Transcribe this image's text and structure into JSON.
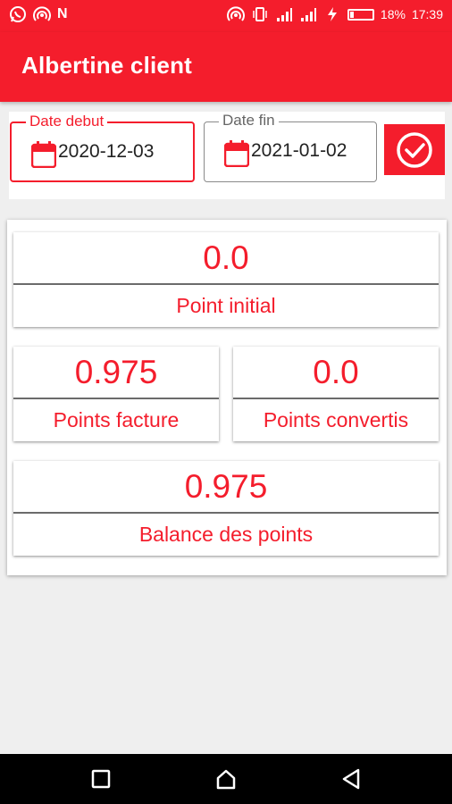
{
  "status_bar": {
    "notification_letter": "N",
    "battery_percent": "18%",
    "battery_level": 0.18,
    "time": "17:39",
    "icons": [
      "whatsapp-icon",
      "hotspot-icon",
      "hotspot-icon",
      "vibrate-icon",
      "signal-icon",
      "signal-icon",
      "charging-icon",
      "battery-icon"
    ]
  },
  "app_bar": {
    "title": "Albertine client"
  },
  "date_filter": {
    "start": {
      "label": "Date debut",
      "value": "2020-12-03"
    },
    "end": {
      "label": "Date fin",
      "value": "2021-01-02"
    },
    "confirm_icon": "check-circle-icon"
  },
  "points": {
    "initial": {
      "value": "0.0",
      "label": "Point initial"
    },
    "facture": {
      "value": "0.975",
      "label": "Points facture"
    },
    "convertis": {
      "value": "0.0",
      "label": "Points convertis"
    },
    "balance": {
      "value": "0.975",
      "label": "Balance des points"
    }
  },
  "nav_bar": {
    "buttons": [
      "recents-icon",
      "home-icon",
      "back-icon"
    ]
  },
  "colors": {
    "primary": "#f41d2c",
    "background": "#efefef"
  }
}
